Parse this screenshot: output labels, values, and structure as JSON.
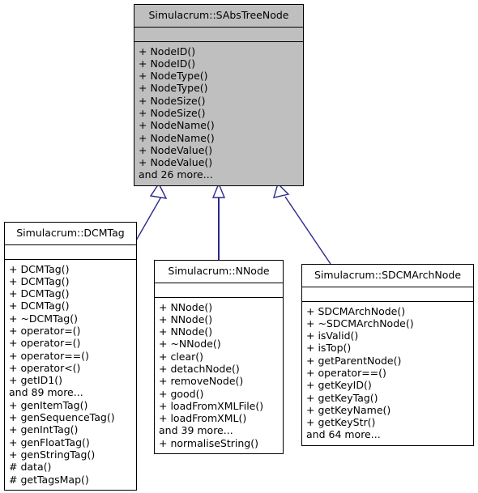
{
  "diagram": {
    "type": "uml-class-inheritance",
    "edge_color": "#2a2a8c",
    "highlight_fill": "#bfbfbf",
    "border_color": "#000000",
    "background": "#ffffff"
  },
  "nodes": [
    {
      "id": "sabstreenode",
      "title": "Simulacrum::SAbsTreeNode",
      "highlighted": true,
      "attributes": [],
      "operations": [
        "+ NodeID()",
        "+ NodeID()",
        "+ NodeType()",
        "+ NodeType()",
        "+ NodeSize()",
        "+ NodeSize()",
        "+ NodeName()",
        "+ NodeName()",
        "+ NodeValue()",
        "+ NodeValue()",
        "and 26 more..."
      ]
    },
    {
      "id": "dcmtag",
      "title": "Simulacrum::DCMTag",
      "highlighted": false,
      "attributes": [],
      "operations": [
        "+ DCMTag()",
        "+ DCMTag()",
        "+ DCMTag()",
        "+ DCMTag()",
        "+ ~DCMTag()",
        "+ operator=()",
        "+ operator=()",
        "+ operator==()",
        "+ operator<()",
        "+ getID1()",
        "and 89 more...",
        "+ genItemTag()",
        "+ genSequenceTag()",
        "+ genIntTag()",
        "+ genFloatTag()",
        "+ genStringTag()",
        "# data()",
        "# getTagsMap()"
      ]
    },
    {
      "id": "nnode",
      "title": "Simulacrum::NNode",
      "highlighted": false,
      "attributes": [],
      "operations": [
        "+ NNode()",
        "+ NNode()",
        "+ NNode()",
        "+ ~NNode()",
        "+ clear()",
        "+ detachNode()",
        "+ removeNode()",
        "+ good()",
        "+ loadFromXMLFile()",
        "+ loadFromXML()",
        "and 39 more...",
        "+ normaliseString()"
      ]
    },
    {
      "id": "sdcmarchnode",
      "title": "Simulacrum::SDCMArchNode",
      "highlighted": false,
      "attributes": [],
      "operations": [
        "+ SDCMArchNode()",
        "+ ~SDCMArchNode()",
        "+ isValid()",
        "+ isTop()",
        "+ getParentNode()",
        "+ operator==()",
        "+ getKeyID()",
        "+ getKeyTag()",
        "+ getKeyName()",
        "+ getKeyStr()",
        "and 64 more..."
      ]
    }
  ],
  "edges": [
    {
      "from": "dcmtag",
      "to": "sabstreenode",
      "kind": "inheritance"
    },
    {
      "from": "nnode",
      "to": "sabstreenode",
      "kind": "inheritance"
    },
    {
      "from": "sdcmarchnode",
      "to": "sabstreenode",
      "kind": "inheritance"
    }
  ]
}
